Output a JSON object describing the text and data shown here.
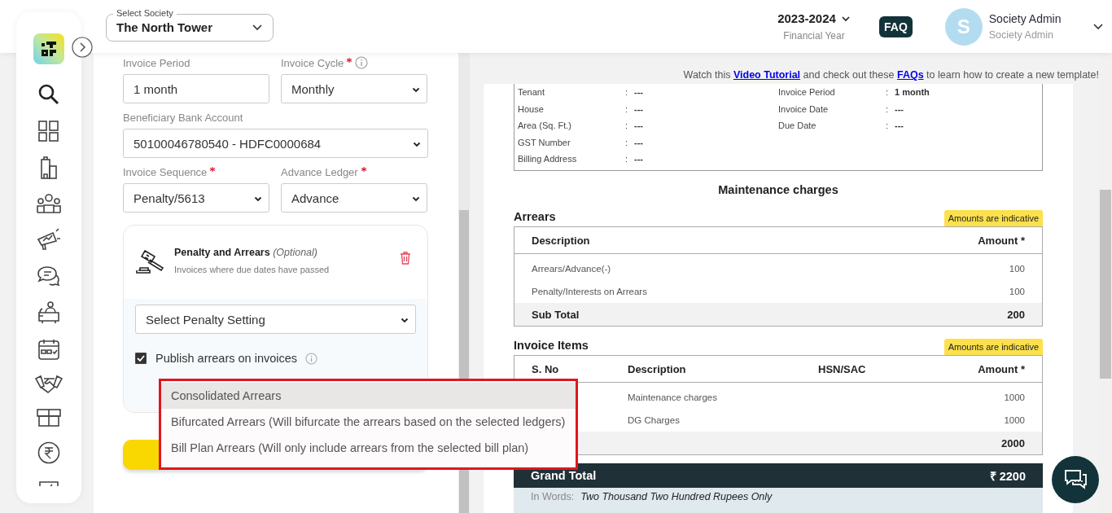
{
  "header": {
    "society_select": {
      "label": "Select Society",
      "value": "The North Tower"
    },
    "financial_year": {
      "value": "2023-2024",
      "label": "Financial Year"
    },
    "faq_button": "FAQ",
    "user": {
      "avatar_letter": "S",
      "name": "Society Admin",
      "role": "Society Admin"
    }
  },
  "form": {
    "fields": [
      {
        "label": "Invoice Period",
        "required": false,
        "info": false,
        "kind": "input",
        "value": "1 month",
        "wide": false
      },
      {
        "label": "Invoice Cycle",
        "required": true,
        "info": true,
        "kind": "select",
        "value": "Monthly",
        "wide": false
      },
      {
        "label": "Beneficiary Bank Account",
        "required": false,
        "info": false,
        "kind": "select",
        "value": "50100046780540 - HDFC0000684",
        "wide": true
      },
      {
        "label": "Invoice Sequence",
        "required": true,
        "info": false,
        "kind": "select",
        "value": "Penalty/5613",
        "wide": false
      },
      {
        "label": "Advance Ledger",
        "required": true,
        "info": false,
        "kind": "select",
        "value": "Advance",
        "wide": false
      }
    ],
    "penalty_card": {
      "title": "Penalty and Arrears",
      "optional": "(Optional)",
      "subtitle": "Invoices where due dates have passed",
      "setting_select": "Select Penalty Setting",
      "publish_checkbox": {
        "label": "Publish arrears on invoices",
        "checked": true
      },
      "arrears_options": [
        {
          "label": "Consolidated Arrears",
          "selected": true
        },
        {
          "label": "Bifurcated Arrears (Will bifurcate the arrears based on the selected ledgers)",
          "selected": false
        },
        {
          "label": "Bill Plan Arrears (Will only include arrears from the selected bill plan)",
          "selected": false
        }
      ]
    }
  },
  "tutorial_note": {
    "before": "Watch this",
    "link_1": "Video Tutorial",
    "middle": "and check out these",
    "link_2": "FAQs",
    "after": "to learn how to create a new template!"
  },
  "invoice": {
    "details_left": [
      {
        "label": "Tenant",
        "separator": ":",
        "value": "---"
      },
      {
        "label": "House",
        "separator": ":",
        "value": "---"
      },
      {
        "label": "Area (Sq. Ft.)",
        "separator": ":",
        "value": "---"
      },
      {
        "label": "GST Number",
        "separator": ":",
        "value": "---"
      },
      {
        "label": "Billing Address",
        "separator": ":",
        "value": "---"
      }
    ],
    "details_right": [
      {
        "label": "Invoice Period",
        "separator": ":",
        "value": "1 month"
      },
      {
        "label": "Invoice Date",
        "separator": ":",
        "value": "---"
      },
      {
        "label": "Due Date",
        "separator": ":",
        "value": "---"
      }
    ],
    "title": "Maintenance charges",
    "arrears": {
      "title": "Arrears",
      "badge": "Amounts are indicative",
      "columns": [
        "Description",
        "Amount *"
      ],
      "rows": [
        {
          "description": "Arrears/Advance(-)",
          "amount": "100"
        },
        {
          "description": "Penalty/Interests on Arrears",
          "amount": "100"
        }
      ],
      "subtotal_label": "Sub Total",
      "subtotal": "200"
    },
    "items": {
      "title": "Invoice Items",
      "badge": "Amounts are indicative",
      "columns": [
        "S. No",
        "Description",
        "HSN/SAC",
        "Amount *"
      ],
      "rows": [
        {
          "description": "Maintenance charges",
          "amount": "1000"
        },
        {
          "description": "DG Charges",
          "amount": "1000"
        }
      ],
      "subtotal": "2000"
    },
    "grand_total": {
      "label": "Grand Total",
      "value": "₹ 2200"
    },
    "in_words": {
      "label": "In Words:",
      "value": "Two Thousand Two Hundred Rupees Only"
    }
  }
}
